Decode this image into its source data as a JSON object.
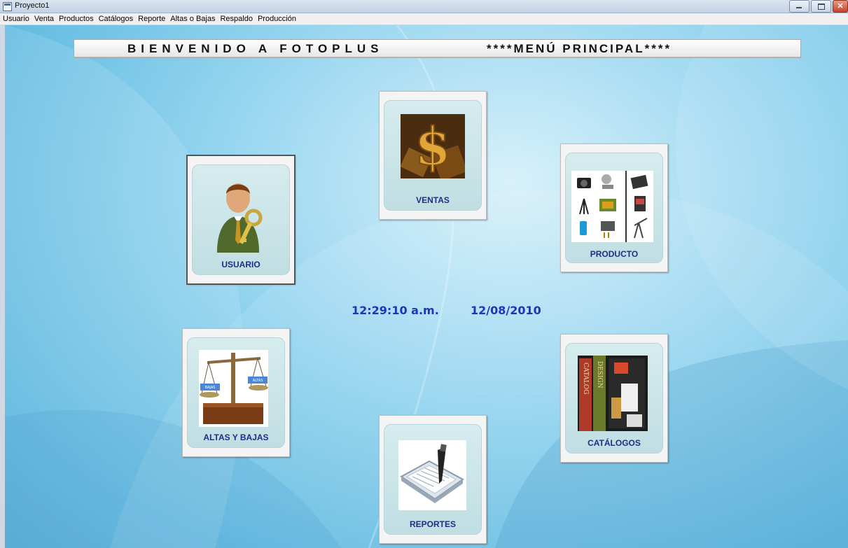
{
  "window": {
    "title": "Proyecto1"
  },
  "menu": [
    "Usuario",
    "Venta",
    "Productos",
    "Catálogos",
    "Reporte",
    "Altas o Bajas",
    "Respaldo",
    "Producción"
  ],
  "banner": {
    "title": "BIENVENIDO A FOTOPLUS",
    "subtitle": "****MENÚ PRINCIPAL****"
  },
  "tiles": {
    "usuario": {
      "label": "USUARIO"
    },
    "ventas": {
      "label": "VENTAS"
    },
    "producto": {
      "label": "PRODUCTO"
    },
    "altas_bajas": {
      "label": "ALTAS Y BAJAS",
      "scale_left": "BAJAS",
      "scale_right": "ALTAS"
    },
    "catalogos": {
      "label": "CATÁLOGOS",
      "spine_left": "CATALOG",
      "spine_right": "DESIGN"
    },
    "reportes": {
      "label": "REPORTES"
    }
  },
  "clock": {
    "time": "12:29:10 a.m.",
    "date": "12/08/2010"
  },
  "colors": {
    "label": "#1d2f86",
    "clock": "#1f35b8",
    "background": "#7cc8ea"
  }
}
